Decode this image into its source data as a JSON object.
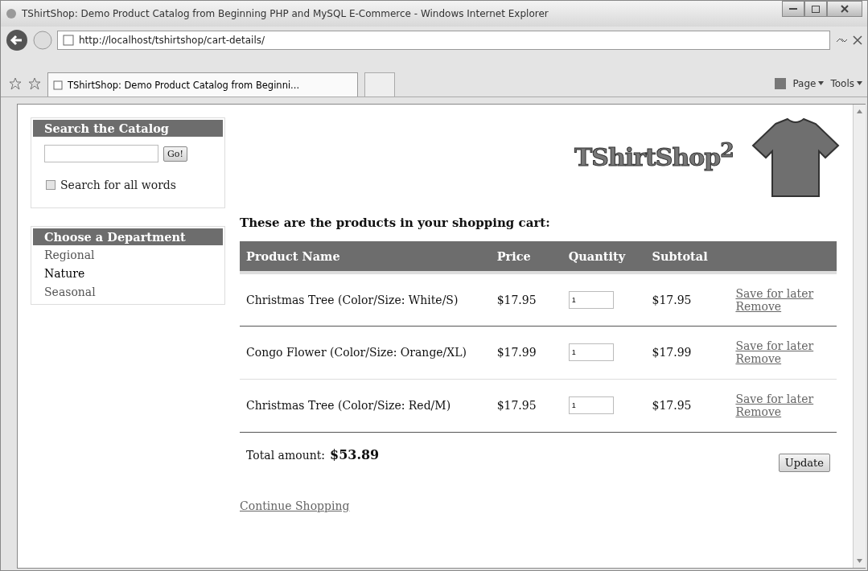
{
  "window": {
    "title": "TShirtShop: Demo Product Catalog from Beginning PHP and MySQL E-Commerce - Windows Internet Explorer"
  },
  "address_bar": {
    "url": "http://localhost/tshirtshop/cart-details/"
  },
  "tab": {
    "label": "TShirtShop: Demo Product Catalog from Beginni..."
  },
  "toolbar": {
    "items": [
      "Page",
      "Tools"
    ]
  },
  "search": {
    "title": "Search the Catalog",
    "button": "Go!",
    "all_words": {
      "label": "Search for all words",
      "checked": false
    }
  },
  "departments": {
    "title": "Choose a Department",
    "items": [
      {
        "label": "Regional",
        "selected": false
      },
      {
        "label": "Nature",
        "selected": true
      },
      {
        "label": "Seasonal",
        "selected": false
      }
    ]
  },
  "logo": {
    "text": "TShirtShop$^{2}$"
  },
  "cart": {
    "heading": "These are the products in your shopping cart:",
    "columns": [
      "Product Name",
      "Price",
      "Quantity",
      "Subtotal"
    ],
    "rows": [
      {
        "name": "Christmas Tree (Color/Size: White/S)",
        "price": "$17.95",
        "quantity": "1",
        "subtotal": "$17.95",
        "actions": [
          "Save for later",
          "Remove"
        ]
      },
      {
        "name": "Congo Flower (Color/Size: Orange/XL)",
        "price": "$17.99",
        "quantity": "1",
        "subtotal": "$17.99",
        "actions": [
          "Save for later",
          "Remove"
        ]
      },
      {
        "name": "Christmas Tree (Color/Size: Red/M)",
        "price": "$17.95",
        "quantity": "1",
        "subtotal": "$17.95",
        "actions": [
          "Save for later",
          "Remove"
        ]
      }
    ],
    "total_label": "Total amount:",
    "total": "$53.89",
    "update_button": "Update",
    "continue_link": "Continue Shopping"
  }
}
